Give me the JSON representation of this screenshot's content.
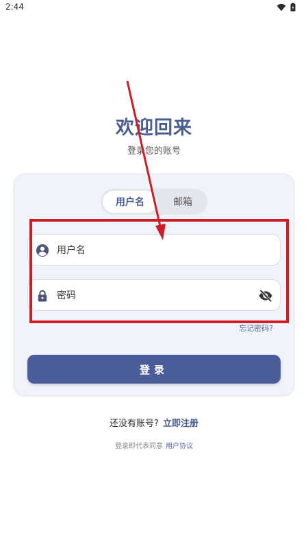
{
  "status_bar": {
    "time": "2:44",
    "icons": [
      "wifi-icon",
      "battery-icon"
    ]
  },
  "header": {
    "title": "欢迎回来",
    "subtitle": "登录您的账号"
  },
  "login_tabs": {
    "items": [
      {
        "label": "用户名",
        "active": true
      },
      {
        "label": "邮箱",
        "active": false
      }
    ]
  },
  "form": {
    "username_placeholder": "用户名",
    "password_placeholder": "密码",
    "forgot_label": "忘记密码?",
    "login_label": "登录"
  },
  "footer": {
    "no_account_text": "还没有账号?",
    "register_label": "立即注册",
    "agreement_text": "登录即代表同意",
    "agreement_link": "用户协议"
  },
  "colors": {
    "accent": "#4a5d98",
    "annotation": "#d01c24",
    "card_bg": "#f1f3fa"
  }
}
